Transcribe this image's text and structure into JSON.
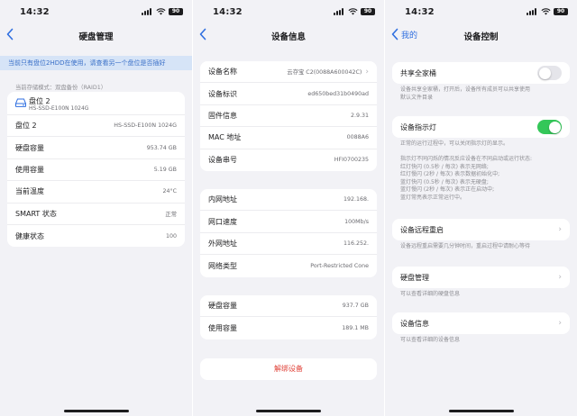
{
  "status": {
    "time": "14:32",
    "battery": "90"
  },
  "screen1": {
    "title": "硬盘管理",
    "banner": "当前只有盘位2HDD在使用，请查看另一个盘位是否插好",
    "mode_caption": "当前存储模式：双盘备份（RAID1）",
    "disk_name": "盘位 2",
    "disk_model": "HS-SSD-E100N 1024G",
    "rows": [
      {
        "label": "盘位 2",
        "value": "HS-SSD-E100N 1024G"
      },
      {
        "label": "硬盘容量",
        "value": "953.74 GB"
      },
      {
        "label": "使用容量",
        "value": "5.19 GB"
      },
      {
        "label": "当前温度",
        "value": "24°C"
      },
      {
        "label": "SMART 状态",
        "value": "正常"
      },
      {
        "label": "健康状态",
        "value": "100"
      }
    ]
  },
  "screen2": {
    "title": "设备信息",
    "group1": [
      {
        "label": "设备名称",
        "value": "云存宝 C2(0088A600042C)"
      },
      {
        "label": "设备标识",
        "value": "ed650bed31b0490ad"
      },
      {
        "label": "固件信息",
        "value": "2.9.31"
      },
      {
        "label": "MAC 地址",
        "value": "0088A6"
      },
      {
        "label": "设备串号",
        "value": "HFI0700235"
      }
    ],
    "group2": [
      {
        "label": "内网地址",
        "value": "192.168."
      },
      {
        "label": "网口速度",
        "value": "100Mb/s"
      },
      {
        "label": "外网地址",
        "value": "116.252."
      },
      {
        "label": "网络类型",
        "value": "Port-Restricted Cone"
      }
    ],
    "group3": [
      {
        "label": "硬盘容量",
        "value": "937.7 GB"
      },
      {
        "label": "使用容量",
        "value": "189.1 MB"
      }
    ],
    "unbind": "解绑设备"
  },
  "screen3": {
    "back_label": "我的",
    "title": "设备控制",
    "share_label": "共享全家桶",
    "share_desc": [
      "设备共享全家桶，打开后，设备所有成员可以共享使用",
      "默认文件目录"
    ],
    "light_label": "设备指示灯",
    "light_desc": [
      "正常的运行过程中，可以关闭指示灯的显示。",
      "",
      "指示灯不同闪烁的情况反应设备在不同启动或运行状态:",
      "红灯快闪 (0.5秒 / 每次) 表示无网络;",
      "红灯慢闪 (2秒 / 每次) 表示数据初始化中;",
      "蓝灯快闪 (0.5秒 / 每次) 表示无硬盘;",
      "蓝灯慢闪 (2秒 / 每次) 表示正在启动中;",
      "蓝灯常亮表示正常运行中。"
    ],
    "reboot_label": "设备远程重启",
    "reboot_desc": "设备远程重启需要几分钟时间，重启过程中请耐心等待",
    "disk_label": "硬盘管理",
    "disk_desc": "可以查看详细的硬盘信息",
    "info_label": "设备信息",
    "info_desc": "可以查看详细的设备信息"
  },
  "colors": {
    "accent": "#2f6fe0",
    "toggle_on": "#34c759",
    "danger": "#e0433a",
    "banner_bg": "#d6e4f7"
  }
}
